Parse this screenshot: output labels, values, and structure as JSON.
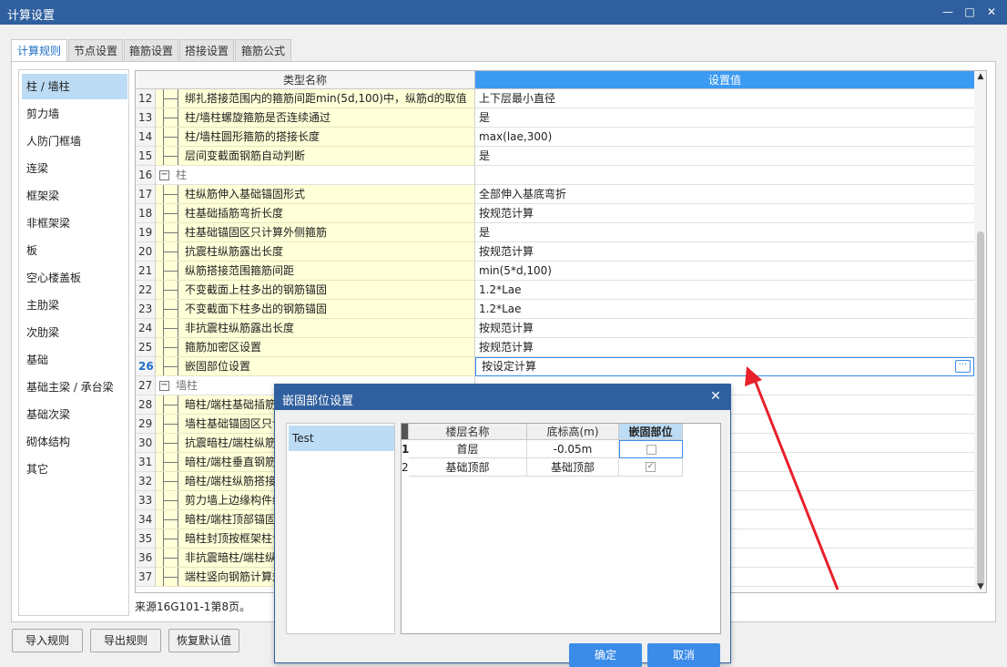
{
  "window": {
    "title": "计算设置"
  },
  "tabs": [
    "计算规则",
    "节点设置",
    "箍筋设置",
    "搭接设置",
    "箍筋公式"
  ],
  "sidebar": [
    "柱 / 墙柱",
    "剪力墙",
    "人防门框墙",
    "连梁",
    "框架梁",
    "非框架梁",
    "板",
    "空心楼盖板",
    "主肋梁",
    "次肋梁",
    "基础",
    "基础主梁 / 承台梁",
    "基础次梁",
    "砌体结构",
    "其它"
  ],
  "grid": {
    "col_name": "类型名称",
    "col_value": "设置值",
    "rows": [
      {
        "num": "12",
        "name": "绑扎搭接范围内的箍筋间距min(5d,100)中，纵筋d的取值",
        "value": "上下层最小直径"
      },
      {
        "num": "13",
        "name": "柱/墙柱螺旋箍筋是否连续通过",
        "value": "是"
      },
      {
        "num": "14",
        "name": "柱/墙柱圆形箍筋的搭接长度",
        "value": "max(lae,300)"
      },
      {
        "num": "15",
        "name": "层间变截面钢筋自动判断",
        "value": "是"
      },
      {
        "num": "16",
        "name": "柱",
        "value": "",
        "group": true
      },
      {
        "num": "17",
        "name": "柱纵筋伸入基础锚固形式",
        "value": "全部伸入基底弯折"
      },
      {
        "num": "18",
        "name": "柱基础插筋弯折长度",
        "value": "按规范计算"
      },
      {
        "num": "19",
        "name": "柱基础锚固区只计算外侧箍筋",
        "value": "是"
      },
      {
        "num": "20",
        "name": "抗震柱纵筋露出长度",
        "value": "按规范计算"
      },
      {
        "num": "21",
        "name": "纵筋搭接范围箍筋间距",
        "value": "min(5*d,100)"
      },
      {
        "num": "22",
        "name": "不变截面上柱多出的钢筋锚固",
        "value": "1.2*Lae"
      },
      {
        "num": "23",
        "name": "不变截面下柱多出的钢筋锚固",
        "value": "1.2*Lae"
      },
      {
        "num": "24",
        "name": "非抗震柱纵筋露出长度",
        "value": "按规范计算"
      },
      {
        "num": "25",
        "name": "箍筋加密区设置",
        "value": "按规范计算"
      },
      {
        "num": "26",
        "name": "嵌固部位设置",
        "value": "按设定计算",
        "current": true
      },
      {
        "num": "27",
        "name": "墙柱",
        "value": "",
        "group": true
      },
      {
        "num": "28",
        "name": "暗柱/端柱基础插筋",
        "value": ""
      },
      {
        "num": "29",
        "name": "墙柱基础锚固区只计",
        "value": ""
      },
      {
        "num": "30",
        "name": "抗震暗柱/端柱纵筋",
        "value": ""
      },
      {
        "num": "31",
        "name": "暗柱/端柱垂直钢筋",
        "value": ""
      },
      {
        "num": "32",
        "name": "暗柱/端柱纵筋搭接",
        "value": ""
      },
      {
        "num": "33",
        "name": "剪力墙上边缘构件纵",
        "value": ""
      },
      {
        "num": "34",
        "name": "暗柱/端柱顶部锚固",
        "value": ""
      },
      {
        "num": "35",
        "name": "暗柱封顶按框架柱计",
        "value": ""
      },
      {
        "num": "36",
        "name": "非抗震暗柱/端柱纵",
        "value": ""
      },
      {
        "num": "37",
        "name": "端柱竖向钢筋计算规",
        "value": ""
      }
    ]
  },
  "source_text": "来源16G101-1第8页。",
  "buttons": {
    "import": "导入规则",
    "export": "导出规则",
    "restore": "恢复默认值"
  },
  "dialog": {
    "title": "嵌固部位设置",
    "list": [
      "Test"
    ],
    "columns": [
      "楼层名称",
      "底标高(m)",
      "嵌固部位"
    ],
    "rows": [
      {
        "num": "1",
        "floor": "首层",
        "elev": "-0.05m",
        "checked": false
      },
      {
        "num": "2",
        "floor": "基础顶部",
        "elev": "基础顶部",
        "checked": true
      }
    ],
    "ok": "确定",
    "cancel": "取消"
  },
  "colors": {
    "titlebar": "#2f5f9e",
    "header_accent": "#3b9af2",
    "row_name_bg": "#ffffd8",
    "annotation_arrow": "#e8202a"
  }
}
